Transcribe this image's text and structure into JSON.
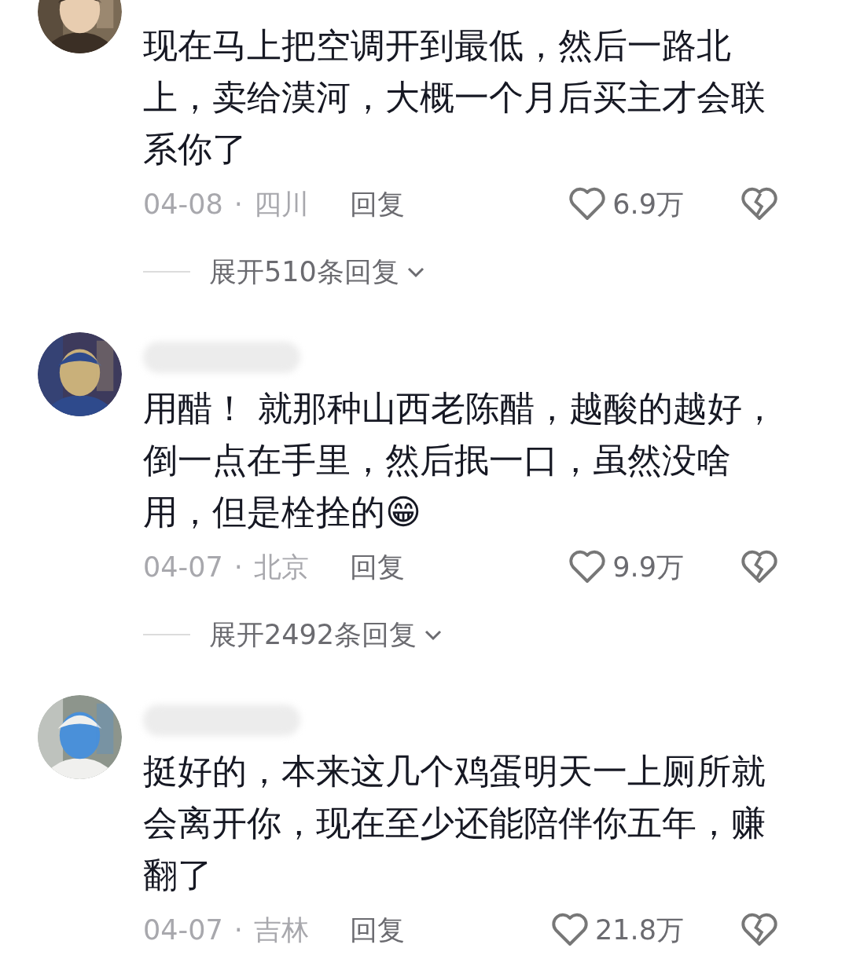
{
  "comments": [
    {
      "text": "现在马上把空调开到最低，然后一路北上，卖给漠河，大概一个月后买主才会联系你了",
      "date": "04-08",
      "separator": "·",
      "location": "四川",
      "reply": "回复",
      "likes": "6.9万",
      "expand": "展开510条回复"
    },
    {
      "text": "用醋！ 就那种山西老陈醋，越酸的越好，倒一点在手里，然后抿一口，虽然没啥用，但是栓拴的😁",
      "date": "04-07",
      "separator": "·",
      "location": "北京",
      "reply": "回复",
      "likes": "9.9万",
      "expand": "展开2492条回复"
    },
    {
      "text": "挺好的，本来这几个鸡蛋明天一上厕所就会离开你，现在至少还能陪伴你五年，赚翻了",
      "date": "04-07",
      "separator": "·",
      "location": "吉林",
      "reply": "回复",
      "likes": "21.8万"
    }
  ]
}
